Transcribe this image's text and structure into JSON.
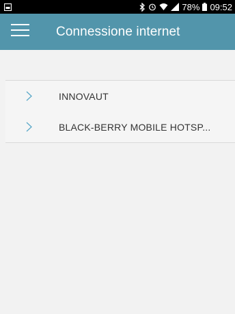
{
  "statusbar": {
    "battery": "78%",
    "time": "09:52",
    "icons": [
      "screenshot-icon",
      "bluetooth-icon",
      "alarm-icon",
      "wifi-icon",
      "signal-icon",
      "battery-icon"
    ]
  },
  "appbar": {
    "title": "Connessione internet",
    "background": "#5295ab",
    "menu_icon": "hamburger-icon"
  },
  "networks": [
    {
      "name": "INNOVAUT"
    },
    {
      "name": "BLACK-BERRY MOBILE HOTSP..."
    }
  ],
  "colors": {
    "chevron": "#5aa8c8",
    "divider": "#d9d9d9"
  }
}
